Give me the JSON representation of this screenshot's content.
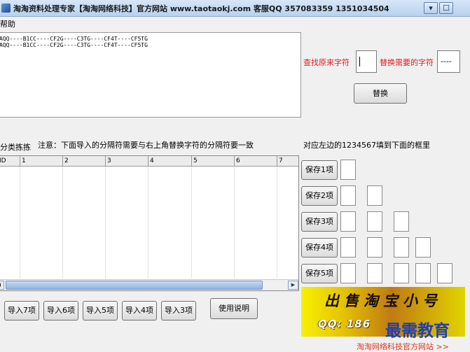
{
  "window": {
    "title": "淘淘资料处理专家【淘淘网络科技】官方网站 www.taotaokj.com 客服QQ 357083359 1351034504",
    "minimize_glyph": "▾",
    "maximize_glyph": "☐"
  },
  "menu": {
    "help": "帮助"
  },
  "editor": {
    "text": "AQQ----B1CC----CF2G----C3TG----CF4T----CF5TG\nAQQ----B1CC----CF2G----C3TG----CF4T----CF5TG"
  },
  "replace": {
    "find_label": "查找原来字符",
    "replace_label": "替换需要的字符",
    "replace_value": "----",
    "replace_button": "替换"
  },
  "grid_section": {
    "left_label": "分类拣拣",
    "note": "注意：下面导入的分隔符需要与右上角替换字符的分隔符要一致",
    "columns": [
      "ID",
      "1",
      "2",
      "3",
      "4",
      "5",
      "6",
      "7"
    ],
    "scroll_left": "◀",
    "scroll_right": "▶"
  },
  "save_section": {
    "hint": "对应左边的1234567填到下面的框里",
    "buttons": [
      "保存1项",
      "保存2项",
      "保存3项",
      "保存4项",
      "保存5项"
    ]
  },
  "import_buttons": [
    "导入7项",
    "导入6项",
    "导入5项",
    "导入4项",
    "导入3项"
  ],
  "usage_button": "使用说明",
  "banner": {
    "top_text": "出售淘宝小号",
    "bottom_text": "QQ: 186"
  },
  "watermark": "最需教育",
  "footer_link": "淘淘网络科技官方网站 >>"
}
